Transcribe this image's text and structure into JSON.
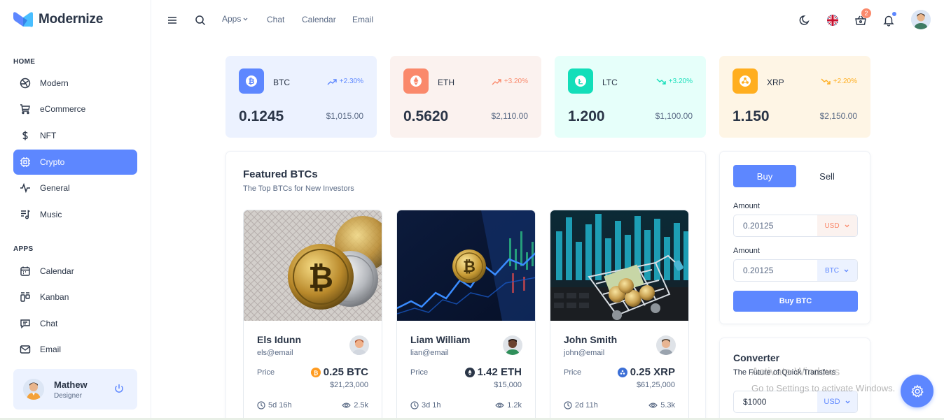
{
  "brand": {
    "name": "Modernize"
  },
  "sidebar": {
    "home_title": "HOME",
    "home_items": [
      {
        "label": "Modern",
        "icon": "aperture-icon"
      },
      {
        "label": "eCommerce",
        "icon": "shopping-cart-icon"
      },
      {
        "label": "NFT",
        "icon": "dollar-icon"
      },
      {
        "label": "Crypto",
        "icon": "cpu-icon",
        "active": true
      },
      {
        "label": "General",
        "icon": "activity-icon"
      },
      {
        "label": "Music",
        "icon": "playlist-icon"
      }
    ],
    "apps_title": "APPS",
    "apps_items": [
      {
        "label": "Calendar",
        "icon": "calendar-icon"
      },
      {
        "label": "Kanban",
        "icon": "kanban-icon"
      },
      {
        "label": "Chat",
        "icon": "message-icon"
      },
      {
        "label": "Email",
        "icon": "mail-icon"
      }
    ],
    "profile": {
      "name": "Mathew",
      "role": "Designer"
    }
  },
  "header": {
    "links": [
      "Apps",
      "Chat",
      "Calendar",
      "Email"
    ],
    "cart_count": "2"
  },
  "coins": [
    {
      "name": "BTC",
      "change": "+2.30%",
      "amount": "0.1245",
      "value": "$1,015.00",
      "bg": "#ecf2ff",
      "icon_bg": "#5d87ff",
      "change_color": "#5d87ff",
      "trend": "up"
    },
    {
      "name": "ETH",
      "change": "+3.20%",
      "amount": "0.5620",
      "value": "$2,110.00",
      "bg": "#fbf2ef",
      "icon_bg": "#fa896b",
      "change_color": "#fa896b",
      "trend": "up"
    },
    {
      "name": "LTC",
      "change": "+3.20%",
      "amount": "1.200",
      "value": "$1,100.00",
      "bg": "#e6fffa",
      "icon_bg": "#13deb9",
      "change_color": "#13deb9",
      "trend": "down"
    },
    {
      "name": "XRP",
      "change": "+2.20%",
      "amount": "1.150",
      "value": "$2,150.00",
      "bg": "#fef5e5",
      "icon_bg": "#ffae1f",
      "change_color": "#ffae1f",
      "trend": "down"
    }
  ],
  "featured": {
    "title": "Featured BTCs",
    "subtitle": "The Top BTCs for New Investors",
    "cards": [
      {
        "name": "Els Idunn",
        "email": "els@email",
        "price_label": "Price",
        "price": "0.25 BTC",
        "usd": "$21,23,000",
        "time": "5d 16h",
        "views": "2.5k",
        "coin_color": "#ff9b1f"
      },
      {
        "name": "Liam William",
        "email": "lian@email",
        "price_label": "Price",
        "price": "1.42 ETH",
        "usd": "$15,000",
        "time": "3d 1h",
        "views": "1.2k",
        "coin_color": "#2a3547"
      },
      {
        "name": "John Smith",
        "email": "john@email",
        "price_label": "Price",
        "price": "0.25 XRP",
        "usd": "$61,25,000",
        "time": "2d 11h",
        "views": "5.3k",
        "coin_color": "#3c6fd6"
      }
    ]
  },
  "trade": {
    "buy_tab": "Buy",
    "sell_tab": "Sell",
    "amount_label": "Amount",
    "amount1": "0.20125",
    "currency1": "USD",
    "amount2": "0.20125",
    "currency2": "BTC",
    "buy_button": "Buy BTC"
  },
  "converter": {
    "title": "Converter",
    "subtitle": "The Future of Quick Transfers",
    "amount": "$1000",
    "currency": "USD"
  },
  "watermark": {
    "line1": "Activate Windows",
    "line2": "Go to Settings to activate Windows."
  }
}
